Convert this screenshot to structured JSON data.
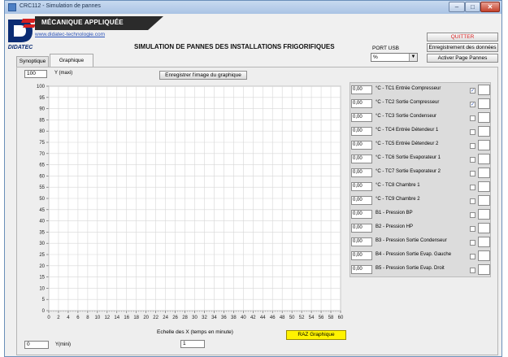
{
  "window": {
    "title": "CRC112 - Simulation de pannes"
  },
  "header": {
    "brand_banner": "MÉCANIQUE APPLIQUÉE",
    "website": "www.didatec-technologie.com",
    "logo_text": "DIDATEC",
    "main_title": "SIMULATION DE PANNES DES INSTALLATIONS FRIGORIFIQUES",
    "port_label": "PORT USB",
    "port_value": "%",
    "quit_label": "QUITTER",
    "save_data_label": "Enregistrement des données",
    "activate_label": "Activer Page Pannes"
  },
  "tabs": [
    {
      "label": "Synoptique",
      "active": false
    },
    {
      "label": "Graphique",
      "active": true
    }
  ],
  "chart_controls": {
    "ymax_value": "100",
    "ymax_label": "Y (maxi)",
    "ymin_value": "0",
    "ymin_label": "Y(mini)",
    "save_image_label": "Enregistrer l'image du graphique",
    "xscale_label": "Echelle des X (temps en minute)",
    "xscale_value": "1",
    "reset_label": "RAZ Graphique",
    "reset_color": "#fff300"
  },
  "chart_data": {
    "type": "line",
    "x_ticks": [
      0,
      2,
      4,
      6,
      8,
      10,
      12,
      14,
      16,
      18,
      20,
      22,
      24,
      26,
      28,
      30,
      32,
      34,
      36,
      38,
      40,
      42,
      44,
      46,
      48,
      50,
      52,
      54,
      56,
      58,
      60
    ],
    "y_ticks": [
      0,
      5,
      10,
      15,
      20,
      25,
      30,
      35,
      40,
      45,
      50,
      55,
      60,
      65,
      70,
      75,
      80,
      85,
      90,
      95,
      100
    ],
    "xlim": [
      0,
      60
    ],
    "ylim": [
      0,
      100
    ],
    "grid": true,
    "series": []
  },
  "sensors": [
    {
      "value": "0,00",
      "label": "°C - TC1 Entrée Compresseur",
      "checked": true
    },
    {
      "value": "0,00",
      "label": "°C - TC2 Sortie Compresseur",
      "checked": true
    },
    {
      "value": "0,00",
      "label": "°C - TC3 Sortie Condenseur",
      "checked": false
    },
    {
      "value": "0,00",
      "label": "°C - TC4 Entrée Détendeur 1",
      "checked": false
    },
    {
      "value": "0,00",
      "label": "°C - TC5 Entrée Détendeur 2",
      "checked": false
    },
    {
      "value": "0,00",
      "label": "°C - TC6 Sortie Evaporateur 1",
      "checked": false
    },
    {
      "value": "0,00",
      "label": "°C - TC7 Sortie Evaporateur 2",
      "checked": false
    },
    {
      "value": "0,00",
      "label": "°C - TC8 Chambre 1",
      "checked": false
    },
    {
      "value": "0,00",
      "label": "°C - TC9 Chambre 2",
      "checked": false
    },
    {
      "value": "0,00",
      "label": "B1 - Pression BP",
      "checked": false
    },
    {
      "value": "0,00",
      "label": "B2 - Pression HP",
      "checked": false
    },
    {
      "value": "0,00",
      "label": "B3 - Pression Sortie Condenseur",
      "checked": false
    },
    {
      "value": "0,00",
      "label": "B4 - Pression Sortie Evap. Gauche",
      "checked": false
    },
    {
      "value": "0,00",
      "label": "B5 - Pression Sortie Evap. Droit",
      "checked": false
    }
  ],
  "colors": {
    "title_bar": "#a9c3e4",
    "banner": "#2b2b2b",
    "link": "#2a52b8",
    "quit": "#d81e1e",
    "logo_blue": "#0b2c73",
    "logo_red": "#d42020",
    "grid": "#d7d7d7"
  },
  "icons": {
    "app": "app-icon",
    "minimize": "minimize-icon",
    "maximize": "maximize-icon",
    "close": "close-icon",
    "dropdown": "chevron-down-icon",
    "check": "checkmark-icon"
  }
}
